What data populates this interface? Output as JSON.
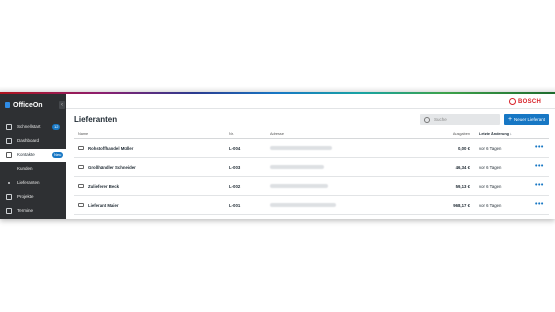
{
  "app": {
    "name": "OfficeOn",
    "brand": "BOSCH"
  },
  "sidebar": {
    "items": [
      {
        "label": "Schnellstart",
        "badge": "12"
      },
      {
        "label": "Dashboard",
        "badge": ""
      },
      {
        "label": "Kontakte",
        "badge": "Neu"
      }
    ],
    "subitems": [
      {
        "label": "Kunden"
      },
      {
        "label": "Lieferanten"
      },
      {
        "label": "Projekte"
      },
      {
        "label": "Termine"
      }
    ]
  },
  "main": {
    "title": "Lieferanten",
    "search_placeholder": "Suche",
    "new_button": "Neuer Lieferant",
    "columns": {
      "name": "Name",
      "nr": "Nr.",
      "address": "Adresse",
      "spend": "Ausgaben",
      "last_change": "Letzte Änderung ↓"
    },
    "rows": [
      {
        "name": "Rohstoffhandel Müller",
        "nr": "L-004",
        "spend": "0,00 €",
        "last_change": "vor 6 Tagen"
      },
      {
        "name": "Großhändler Schneider",
        "nr": "L-003",
        "spend": "46,34 €",
        "last_change": "vor 6 Tagen"
      },
      {
        "name": "Zulieferer Beck",
        "nr": "L-002",
        "spend": "59,13 €",
        "last_change": "vor 6 Tagen"
      },
      {
        "name": "Lieferant Maier",
        "nr": "L-001",
        "spend": "968,17 €",
        "last_change": "vor 6 Tagen"
      }
    ],
    "more_glyph": "•••"
  },
  "colors": {
    "accent": "#1777c4",
    "sidebar_bg": "#2e3033",
    "brand_red": "#d8232a"
  }
}
